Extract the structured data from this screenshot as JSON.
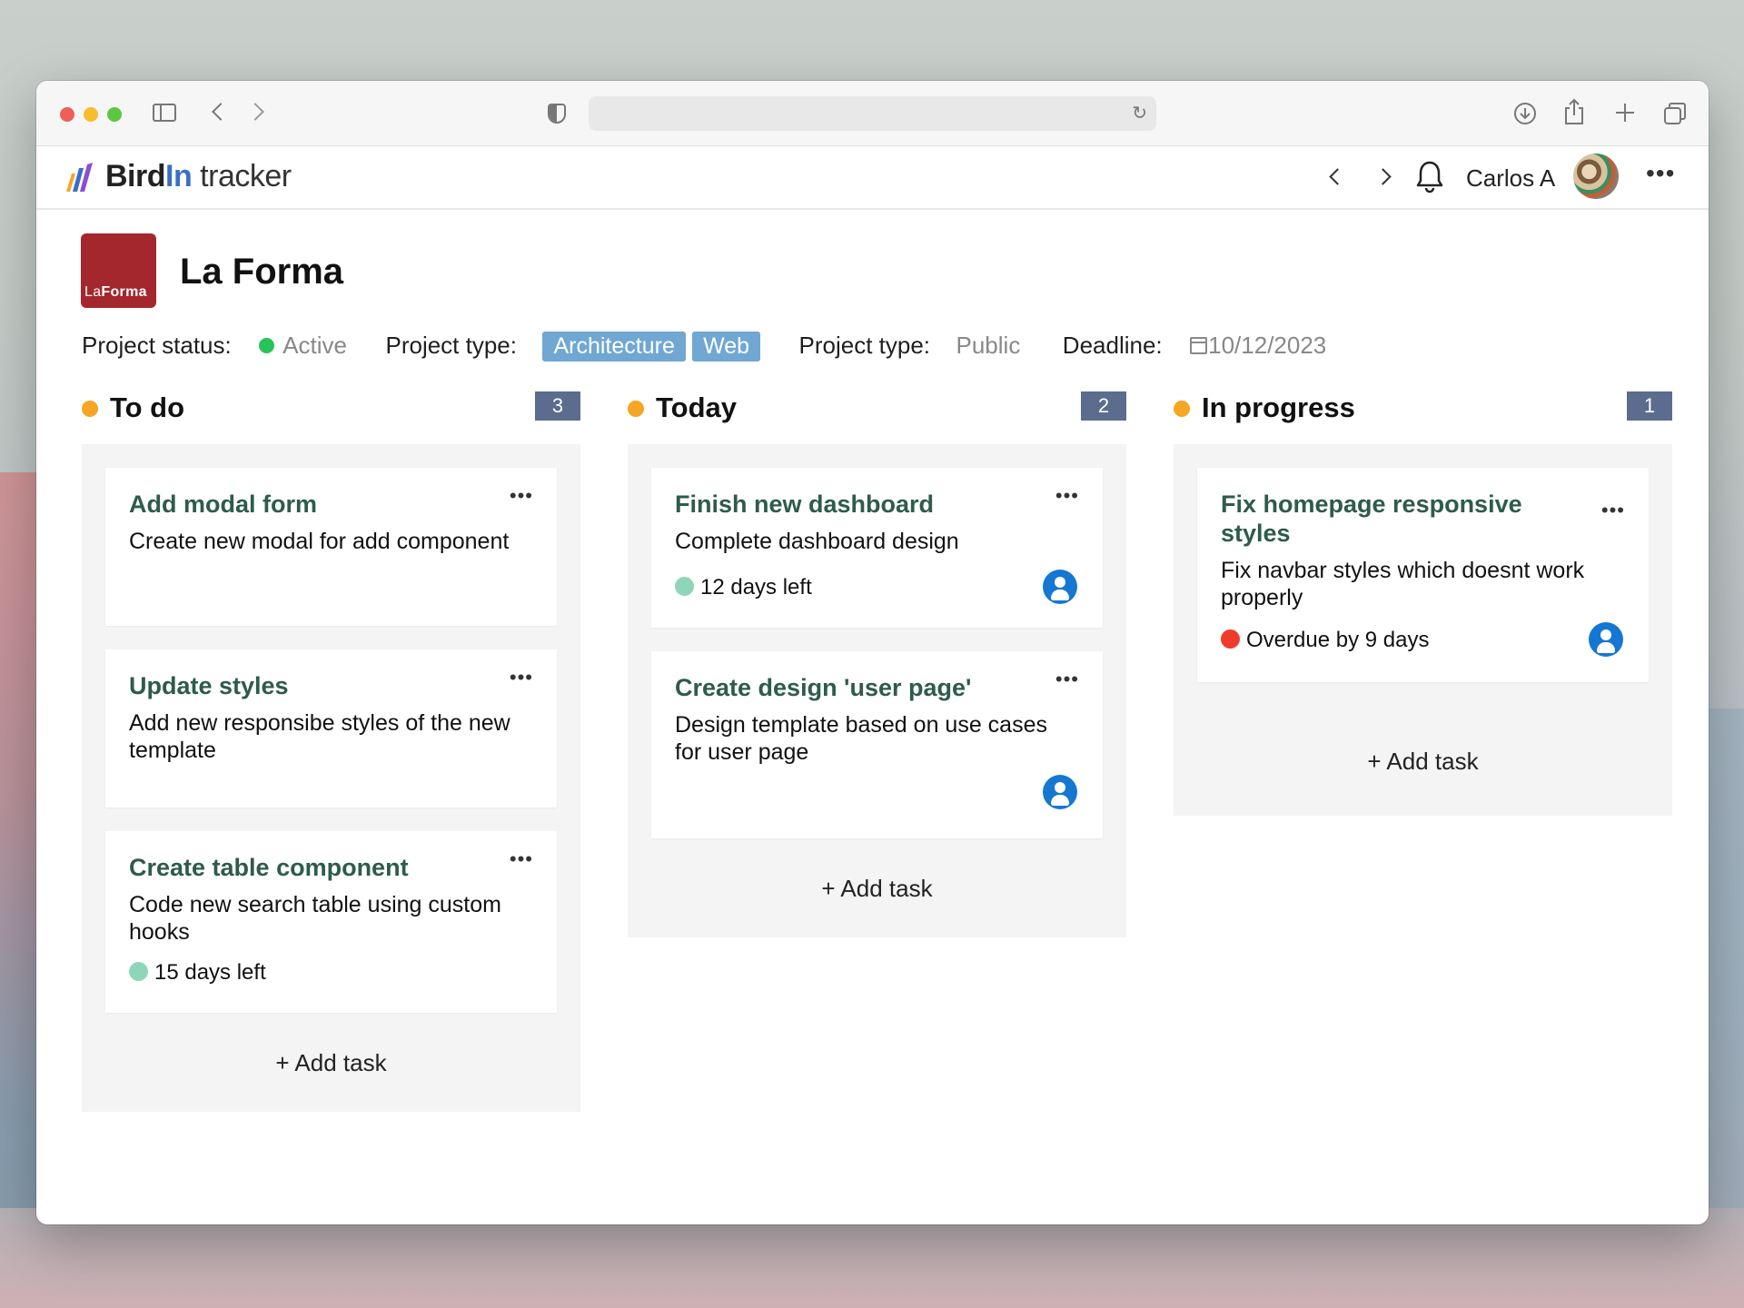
{
  "app": {
    "brand_bird": "Bird",
    "brand_in": "In",
    "brand_tracker": "tracker",
    "user_name": "Carlos A"
  },
  "project": {
    "logo_text_la": "La",
    "logo_text_forma": "Forma",
    "name": "La Forma",
    "status_label": "Project status:",
    "status_value": "Active",
    "type_label": "Project type:",
    "tags": [
      "Architecture",
      "Web"
    ],
    "visibility_label": "Project type:",
    "visibility_value": "Public",
    "deadline_label": "Deadline:",
    "deadline_value": "10/12/2023"
  },
  "columns": [
    {
      "title": "To do",
      "count": "3",
      "add_label": "+ Add task",
      "cards": [
        {
          "title": "Add modal form",
          "desc": "Create new modal for add component"
        },
        {
          "title": "Update styles",
          "desc": "Add new responsibe styles of the new template"
        },
        {
          "title": "Create table component",
          "desc": "Code new search table using custom hooks",
          "due": "15 days left",
          "due_state": "ok"
        }
      ]
    },
    {
      "title": "Today",
      "count": "2",
      "add_label": "+ Add task",
      "cards": [
        {
          "title": "Finish new dashboard",
          "desc": "Complete dashboard design",
          "due": "12 days left",
          "due_state": "ok",
          "assignee": "user-icon"
        },
        {
          "title": "Create design 'user page'",
          "desc": "Design template based on use cases for user page",
          "assignee": "user-icon"
        }
      ]
    },
    {
      "title": "In progress",
      "count": "1",
      "add_label": "+ Add task",
      "cards": [
        {
          "title": "Fix homepage responsive styles",
          "desc": "Fix navbar styles which doesnt work properly",
          "due": "Overdue by 9 days",
          "due_state": "bad",
          "assignee": "user-icon"
        }
      ]
    }
  ],
  "colors": {
    "accent_status": "#f5a623",
    "count_badge": "#5b6c8e",
    "card_title": "#2e5b4c",
    "tag_bg": "#70a7d3",
    "overdue": "#ee3b2c",
    "due_ok": "#8fd6b9",
    "assignee": "#1677d2"
  },
  "icons": {
    "menu": "more-horizontal-icon",
    "notifications": "bell-icon",
    "deadline": "calendar-icon"
  }
}
